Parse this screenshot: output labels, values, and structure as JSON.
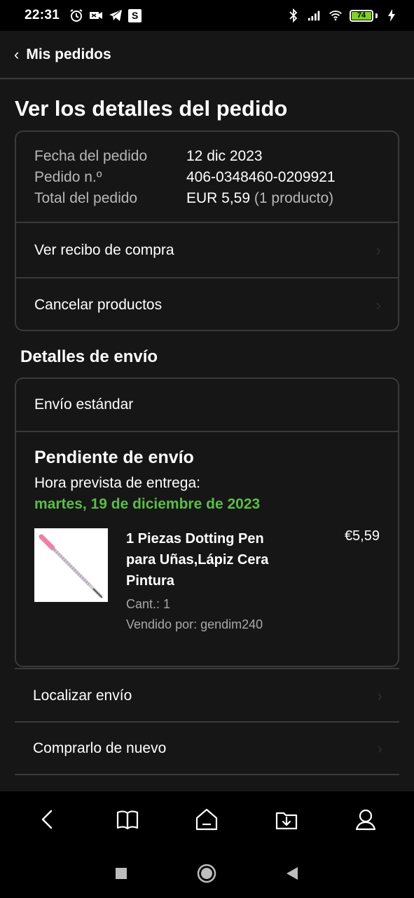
{
  "status_bar": {
    "time": "22:31",
    "s_badge": "S",
    "battery_level": "74",
    "icons_left": [
      "alarm-icon",
      "vpn-icon",
      "telegram-icon",
      "s-app-icon"
    ],
    "icons_right": [
      "bluetooth-icon",
      "signal-icon",
      "wifi-icon",
      "battery-icon",
      "charging-icon"
    ]
  },
  "topnav": {
    "back_label": "Mis pedidos"
  },
  "page": {
    "title": "Ver los detalles del pedido"
  },
  "order_summary": {
    "rows": [
      {
        "label": "Fecha del pedido",
        "value": "12 dic 2023",
        "extra": ""
      },
      {
        "label": "Pedido n.º",
        "value": "406-0348460-0209921",
        "extra": ""
      },
      {
        "label": "Total del pedido",
        "value": "EUR 5,59",
        "extra": "(1 producto)"
      }
    ],
    "links": [
      "Ver recibo de compra",
      "Cancelar productos"
    ]
  },
  "shipping": {
    "section_title": "Detalles de envío",
    "type": "Envío estándar",
    "status": "Pendiente de envío",
    "delivery_label": "Hora prevista de entrega:",
    "delivery_date": "martes, 19 de diciembre de 2023",
    "delivery_color": "#5cbc4a",
    "product": {
      "name": "1 Piezas Dotting Pen para Uñas,Lápiz Cera Pintura",
      "quantity": "Cant.: 1",
      "seller": "Vendido por: gendim240",
      "price": "€5,59"
    }
  },
  "actions": [
    "Localizar envío",
    "Comprarlo de nuevo"
  ],
  "bottom_bar": [
    "back-icon",
    "book-icon",
    "home-icon",
    "download-icon",
    "account-icon"
  ],
  "system_nav": [
    "recents-icon",
    "home-circle-icon",
    "back-triangle-icon"
  ]
}
